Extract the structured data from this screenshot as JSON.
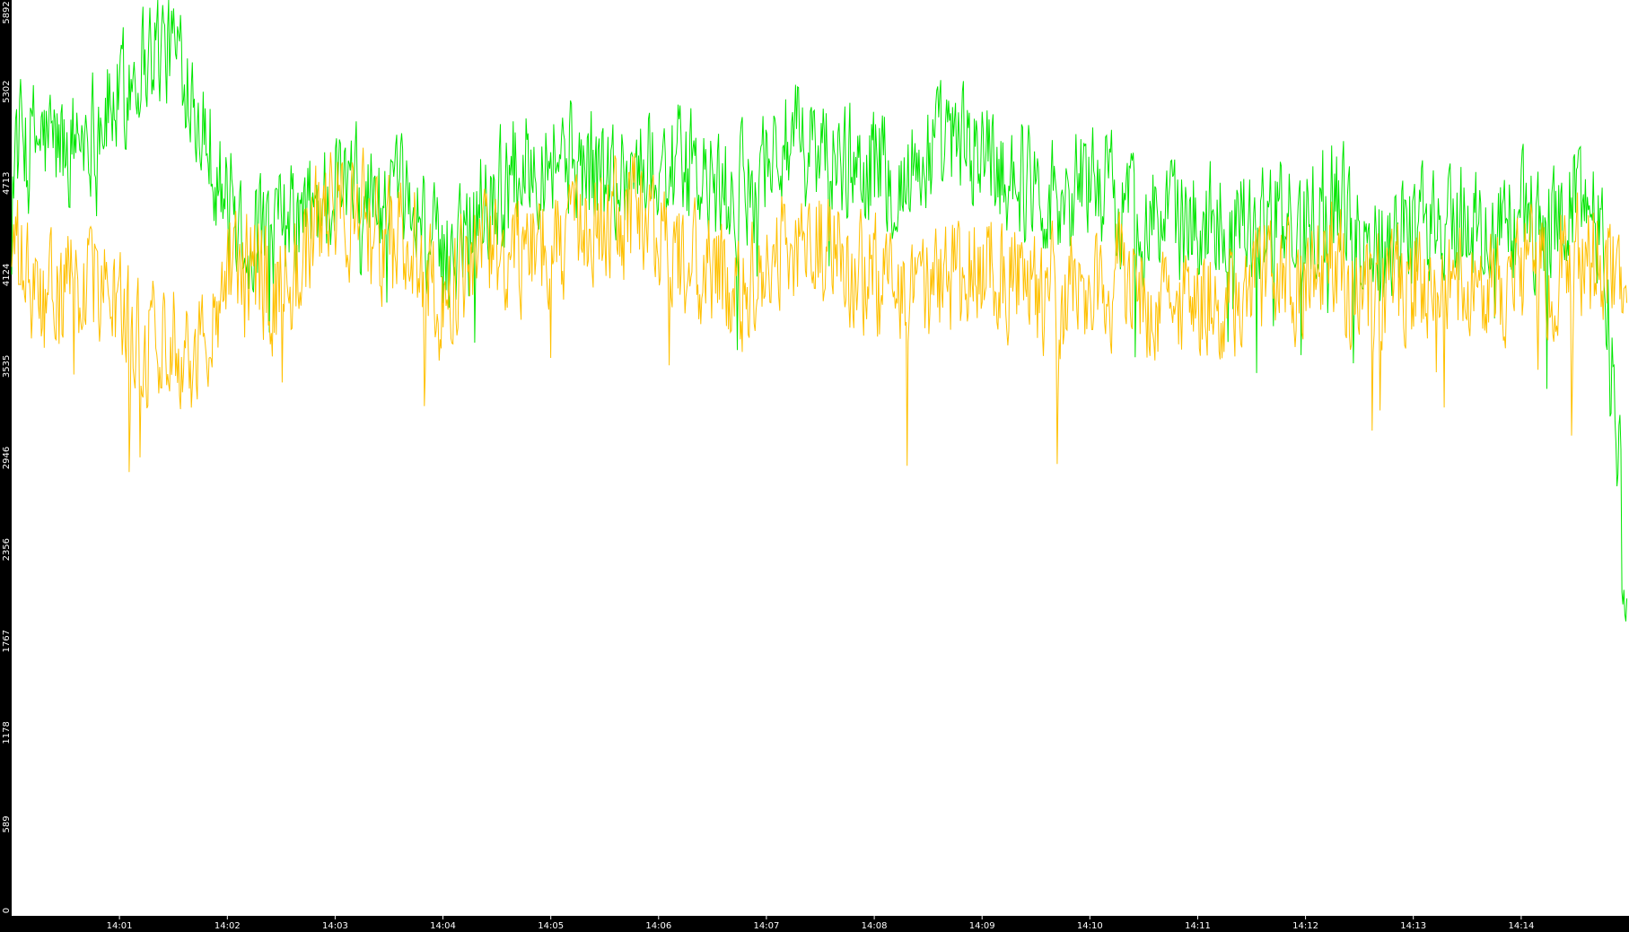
{
  "chart_data": {
    "type": "line",
    "title": "",
    "xlabel": "",
    "ylabel": "",
    "background": "#000000",
    "plot_background": "#ffffff",
    "axis_text_color": "#ffffff",
    "grid": false,
    "legend": "none",
    "xlim": [
      "14:00:00",
      "14:15:00"
    ],
    "ylim": [
      0,
      5892
    ],
    "y_ticks": [
      "0",
      "589",
      "1178",
      "1767",
      "2356",
      "2946",
      "3535",
      "4124",
      "4713",
      "5302",
      "5892"
    ],
    "x_ticks": [
      "14:01",
      "14:02",
      "14:03",
      "14:04",
      "14:05",
      "14:06",
      "14:07",
      "14:08",
      "14:09",
      "14:10",
      "14:11",
      "14:12",
      "14:13",
      "14:14"
    ],
    "series": [
      {
        "color": "#00e600",
        "x": [
          "14:00:00",
          "14:00:15",
          "14:00:30",
          "14:00:45",
          "14:01:00",
          "14:01:10",
          "14:01:20",
          "14:01:30",
          "14:01:40",
          "14:01:50",
          "14:02:00",
          "14:02:15",
          "14:02:30",
          "14:02:45",
          "14:03:00",
          "14:03:15",
          "14:03:30",
          "14:03:45",
          "14:04:00",
          "14:04:15",
          "14:04:30",
          "14:04:45",
          "14:05:00",
          "14:05:15",
          "14:05:30",
          "14:05:45",
          "14:06:00",
          "14:06:15",
          "14:06:30",
          "14:06:45",
          "14:07:00",
          "14:07:15",
          "14:07:30",
          "14:07:45",
          "14:08:00",
          "14:08:15",
          "14:08:30",
          "14:08:45",
          "14:09:00",
          "14:09:15",
          "14:09:30",
          "14:09:45",
          "14:10:00",
          "14:10:15",
          "14:10:30",
          "14:10:45",
          "14:11:00",
          "14:11:15",
          "14:11:30",
          "14:11:45",
          "14:12:00",
          "14:12:15",
          "14:12:30",
          "14:12:45",
          "14:13:00",
          "14:13:15",
          "14:13:30",
          "14:13:45",
          "14:14:00",
          "14:14:15",
          "14:14:30",
          "14:14:45",
          "14:15:00"
        ],
        "values": [
          4950,
          5000,
          4950,
          5100,
          5250,
          5500,
          5600,
          5580,
          5400,
          5000,
          4550,
          4350,
          4400,
          4500,
          4700,
          4650,
          4550,
          4550,
          4150,
          4600,
          4650,
          4850,
          4950,
          4850,
          4750,
          4800,
          4850,
          4800,
          4650,
          4600,
          4900,
          4950,
          4900,
          4850,
          4850,
          4700,
          4900,
          4950,
          4950,
          4800,
          4700,
          4600,
          4800,
          4600,
          4500,
          4450,
          4450,
          4550,
          4500,
          4450,
          4450,
          4700,
          4350,
          4400,
          4450,
          4450,
          4450,
          4400,
          4500,
          4400,
          4650,
          4500,
          2000
        ]
      },
      {
        "color": "#ffc000",
        "x": [
          "14:00:00",
          "14:00:15",
          "14:00:30",
          "14:00:45",
          "14:01:00",
          "14:01:10",
          "14:01:20",
          "14:01:30",
          "14:01:40",
          "14:01:50",
          "14:02:00",
          "14:02:15",
          "14:02:30",
          "14:02:45",
          "14:03:00",
          "14:03:15",
          "14:03:30",
          "14:03:45",
          "14:04:00",
          "14:04:15",
          "14:04:30",
          "14:04:45",
          "14:05:00",
          "14:05:15",
          "14:05:30",
          "14:05:45",
          "14:06:00",
          "14:06:15",
          "14:06:30",
          "14:06:45",
          "14:07:00",
          "14:07:15",
          "14:07:30",
          "14:07:45",
          "14:08:00",
          "14:08:15",
          "14:08:30",
          "14:08:45",
          "14:09:00",
          "14:09:15",
          "14:09:30",
          "14:09:45",
          "14:10:00",
          "14:10:15",
          "14:10:30",
          "14:10:45",
          "14:11:00",
          "14:11:15",
          "14:11:30",
          "14:11:45",
          "14:12:00",
          "14:12:15",
          "14:12:30",
          "14:12:45",
          "14:13:00",
          "14:13:15",
          "14:13:30",
          "14:13:45",
          "14:14:00",
          "14:14:15",
          "14:14:30",
          "14:14:45",
          "14:15:00"
        ],
        "values": [
          4300,
          3900,
          4000,
          4100,
          3900,
          3700,
          3700,
          3800,
          3600,
          3700,
          4300,
          4100,
          4000,
          4300,
          4600,
          4500,
          4350,
          4300,
          3900,
          4200,
          4250,
          4300,
          4400,
          4300,
          4400,
          4500,
          4400,
          4200,
          4100,
          4000,
          4200,
          4300,
          4350,
          4200,
          4100,
          3900,
          4000,
          4250,
          4200,
          4100,
          4000,
          4000,
          4000,
          4100,
          4000,
          3900,
          4000,
          3900,
          4100,
          4000,
          4000,
          4300,
          3900,
          4050,
          4100,
          4200,
          4100,
          4100,
          4150,
          4100,
          4250,
          4200,
          4000
        ]
      }
    ]
  }
}
